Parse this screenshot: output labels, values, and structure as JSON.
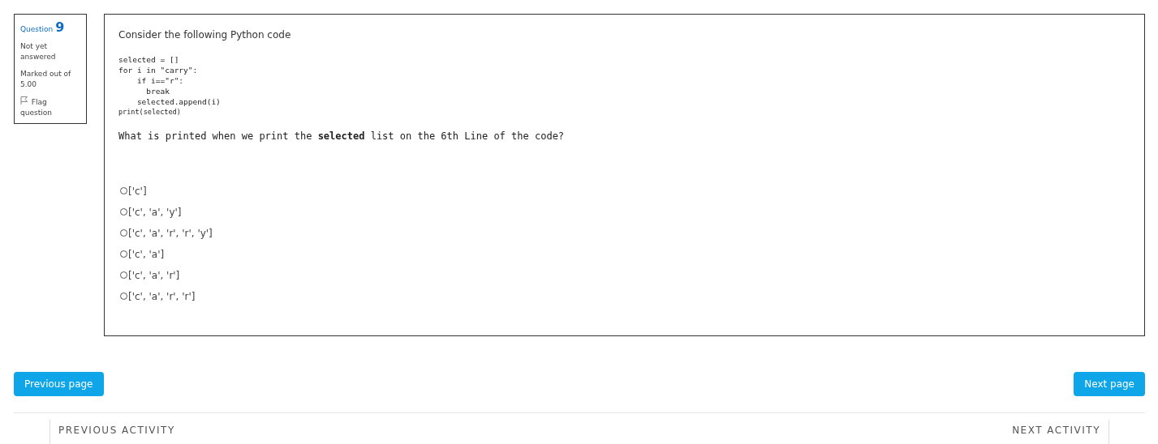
{
  "question_info": {
    "label": "Question",
    "number": "9",
    "status": "Not yet answered",
    "mark": "Marked out of 5.00",
    "flag": {
      "label": "Flag question",
      "flagged": false
    }
  },
  "question": {
    "intro": "Consider the following Python code",
    "code": [
      "selected = []",
      "for i in \"carry\":",
      "    if i==\"r\":",
      "      break",
      "    selected.append(i)"
    ],
    "code_last_line": "print(selected)",
    "prompt": "What is printed when we print the **selected** list on the 6th Line of the code?",
    "options": [
      {
        "label": "['c']",
        "selected": false
      },
      {
        "label": "['c', 'a', 'y']",
        "selected": false
      },
      {
        "label": "['c', 'a', 'r', 'r', 'y']",
        "selected": false
      },
      {
        "label": "['c', 'a']",
        "selected": false
      },
      {
        "label": "['c', 'a', 'r']",
        "selected": false
      },
      {
        "label": "['c', 'a', 'r', 'r']",
        "selected": false
      }
    ]
  },
  "buttons": {
    "previous": "Previous page",
    "next": "Next page"
  },
  "activity_nav": {
    "previous": "PREVIOUS ACTIVITY",
    "next": "NEXT ACTIVITY"
  }
}
